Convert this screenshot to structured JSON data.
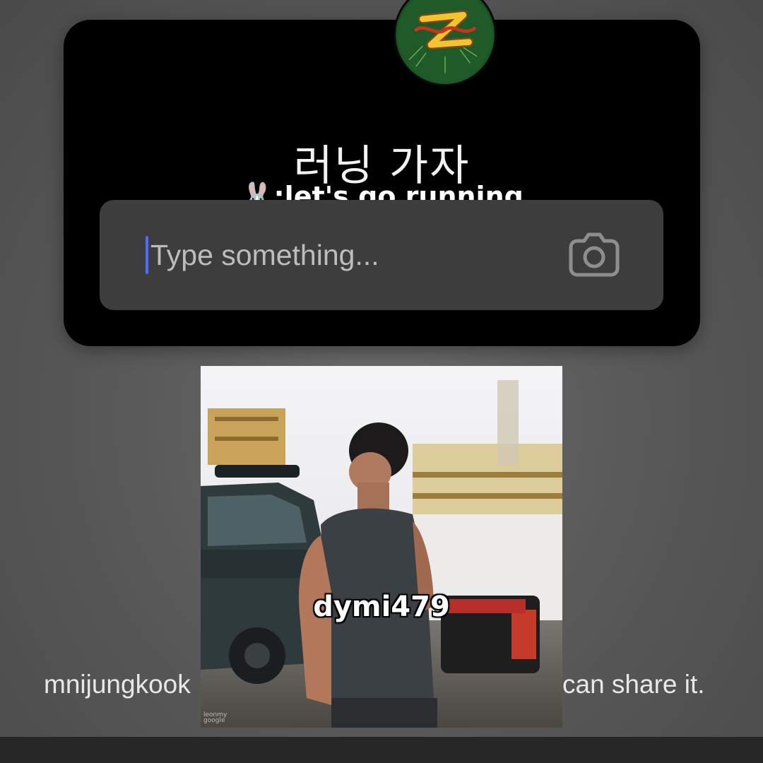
{
  "card": {
    "prompt_korean": "러닝 가자",
    "prompt_english_emoji": "🐰",
    "prompt_english": ":let's go running",
    "input": {
      "placeholder": "Type something...",
      "value": ""
    }
  },
  "share_text": {
    "left": "mnijungkook",
    "right": "can share it."
  },
  "video": {
    "caption": "dymi479",
    "watermark": "leonmy google"
  },
  "icons": {
    "avatar": "letter-z-logo-icon",
    "camera": "camera-icon"
  },
  "colors": {
    "caret": "#4f6bff",
    "card_background": "#000000",
    "input_background": "#3d3d3d"
  }
}
